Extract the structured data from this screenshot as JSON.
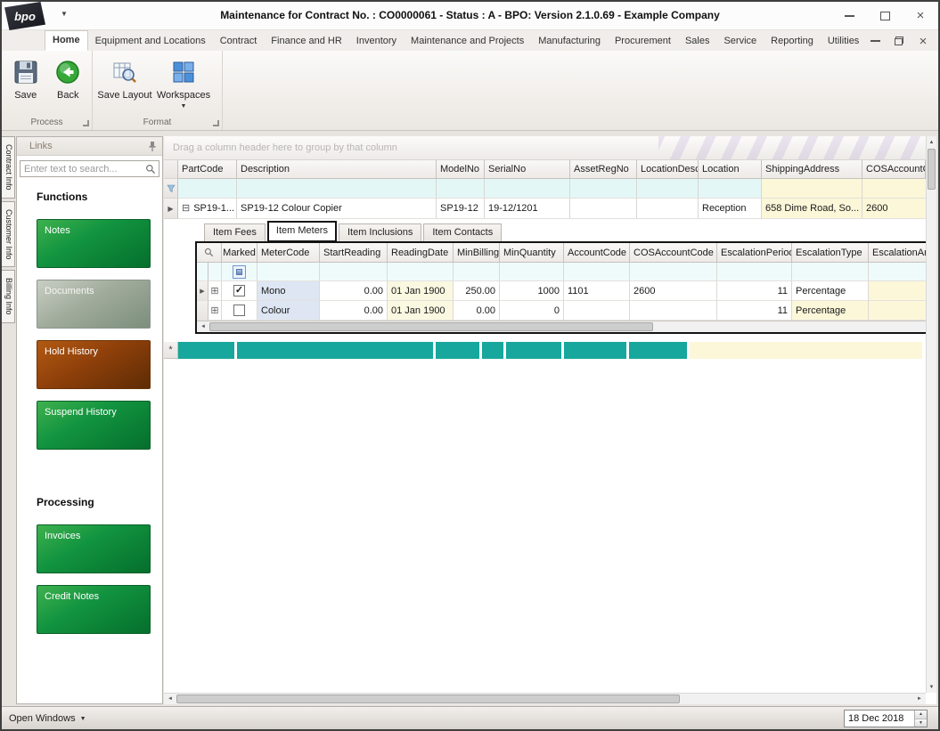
{
  "window": {
    "logo_text": "bpo",
    "title": "Maintenance for Contract No. : CO0000061 - Status : A - BPO: Version 2.1.0.69 - Example Company"
  },
  "icons": {
    "dropdown": "▼",
    "close": "×",
    "row_arrow": "▶",
    "expand_open": "⊟",
    "expand_closed": "⊞",
    "check": "✓",
    "scroll_left": "◄",
    "scroll_right": "►",
    "scroll_up": "▲",
    "scroll_down": "▼",
    "spin_up": "▲",
    "spin_down": "▼"
  },
  "ribbon": {
    "tabs": [
      "Home",
      "Equipment and Locations",
      "Contract",
      "Finance and HR",
      "Inventory",
      "Maintenance and Projects",
      "Manufacturing",
      "Procurement",
      "Sales",
      "Service",
      "Reporting",
      "Utilities"
    ],
    "active_tab": "Home",
    "buttons": {
      "save": "Save",
      "back": "Back",
      "save_layout": "Save Layout",
      "workspaces": "Workspaces"
    },
    "groups": {
      "process": "Process",
      "format": "Format"
    }
  },
  "side_tabs": [
    "Contract Info",
    "Customer Info",
    "Billing Info"
  ],
  "links": {
    "title": "Links",
    "search_placeholder": "Enter text to search...",
    "functions_heading": "Functions",
    "processing_heading": "Processing",
    "function_buttons": [
      {
        "label": "Notes",
        "style": "green"
      },
      {
        "label": "Documents",
        "style": "muted"
      },
      {
        "label": "Hold History",
        "style": "rust"
      },
      {
        "label": "Suspend History",
        "style": "green"
      }
    ],
    "processing_buttons": [
      {
        "label": "Invoices",
        "style": "green"
      },
      {
        "label": "Credit Notes",
        "style": "green"
      }
    ]
  },
  "grid": {
    "group_hint": "Drag a column header here to group by that column",
    "columns": [
      "PartCode",
      "Description",
      "ModelNo",
      "SerialNo",
      "AssetRegNo",
      "LocationDesc",
      "Location",
      "ShippingAddress",
      "COSAccountCode"
    ],
    "row": {
      "PartCode": "SP19-1...",
      "Description": "SP19-12 Colour Copier",
      "ModelNo": "SP19-12",
      "SerialNo": "19-12/1201",
      "AssetRegNo": "",
      "LocationDesc": "",
      "Location": "Reception",
      "ShippingAddress": "658 Dime Road, So...",
      "COSAccountCode": "2600"
    },
    "new_row_marker": "*"
  },
  "detail": {
    "tabs": [
      "Item Fees",
      "Item Meters",
      "Item Inclusions",
      "Item Contacts"
    ],
    "active_tab": "Item Meters",
    "columns": [
      "Marked",
      "MeterCode",
      "StartReading",
      "ReadingDate",
      "MinBilling",
      "MinQuantity",
      "AccountCode",
      "COSAccountCode",
      "EscalationPeriod",
      "EscalationType",
      "EscalationAmount"
    ],
    "rows": [
      {
        "Marked": true,
        "MeterCode": "Mono",
        "StartReading": "0.00",
        "ReadingDate": "01 Jan 1900",
        "MinBilling": "250.00",
        "MinQuantity": "1000",
        "AccountCode": "1101",
        "COSAccountCode": "2600",
        "EscalationPeriod": "11",
        "EscalationType": "Percentage",
        "EscalationAmount": ""
      },
      {
        "Marked": false,
        "MeterCode": "Colour",
        "StartReading": "0.00",
        "ReadingDate": "01 Jan 1900",
        "MinBilling": "0.00",
        "MinQuantity": "0",
        "AccountCode": "",
        "COSAccountCode": "",
        "EscalationPeriod": "11",
        "EscalationType": "Percentage",
        "EscalationAmount": ""
      }
    ]
  },
  "status": {
    "open_windows": "Open Windows",
    "date": "18 Dec 2018"
  },
  "colors": {
    "teal_new_row": "#17a79c",
    "green_button": "#129440",
    "rust_button": "#8f400a",
    "muted_button": "#a0ab9b",
    "pale_yellow_cell": "#fbf7d8",
    "filter_cyan_cell": "#e4f7f7",
    "highlight_border": "#141414"
  }
}
